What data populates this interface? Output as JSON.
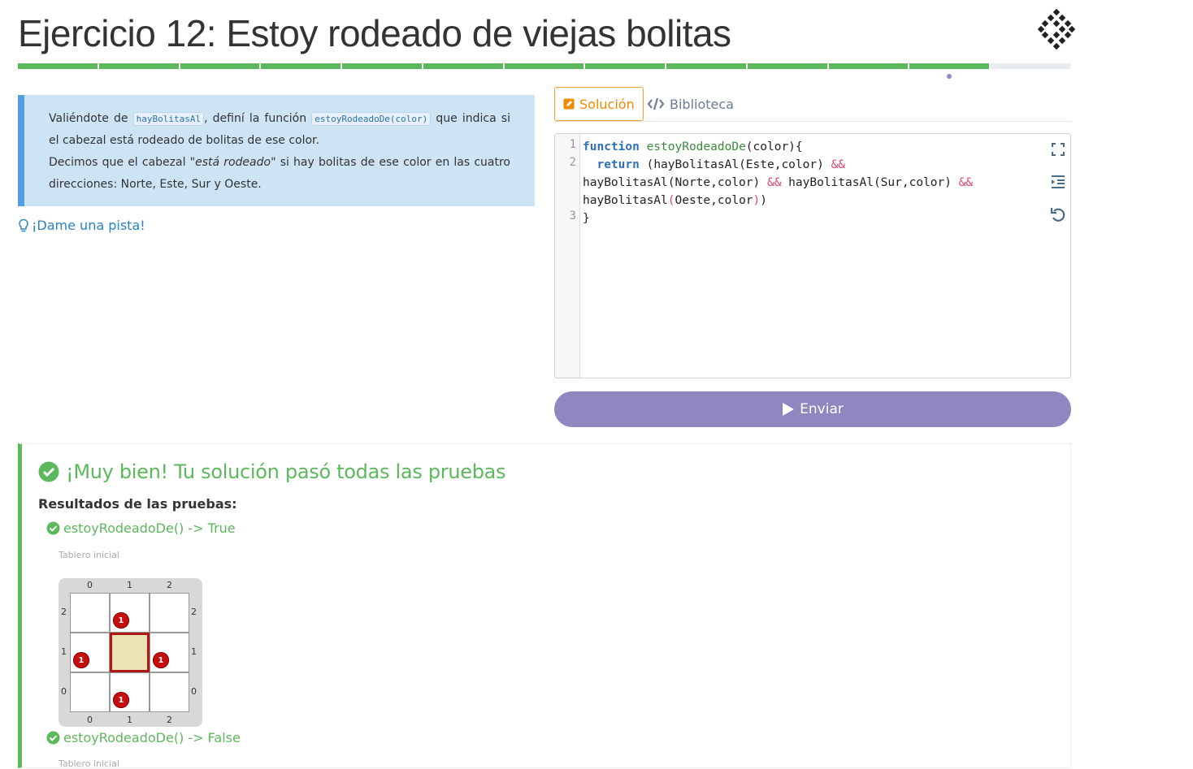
{
  "header": {
    "title": "Ejercicio 12: Estoy rodeado de viejas bolitas"
  },
  "progress": {
    "completed_segments": 12,
    "total_segments": 13,
    "current_index": 12
  },
  "statement": {
    "p1_before": "Valiéndote de",
    "p1_code1": "hayBolitasAl",
    "p1_mid": ", definí la función",
    "p1_code2": "estoyRodeadoDe(color)",
    "p1_after": "que indica si el cabezal está rodeado de bolitas de ese color.",
    "p2_before": "Decimos que el cabezal",
    "p2_quote": "\"está rodeado\"",
    "p2_after": "si hay bolitas de ese color en las cuatro direcciones: Norte, Este, Sur y Oeste."
  },
  "hint": {
    "label": "¡Dame una pista!"
  },
  "tabs": {
    "solution": "Solución",
    "library": "Biblioteca"
  },
  "editor": {
    "line_numbers": [
      "1",
      "2",
      "3"
    ],
    "line1_kw": "function",
    "line1_fn": "estoyRodeadoDe",
    "line1_rest": "(color){",
    "line2_kw": "return",
    "line2_rest": " (hayBolitasAl(Este,color) ",
    "and_op": "&&",
    "line2b_a": "hayBolitasAl(Norte,color) ",
    "line2b_b": " hayBolitasAl(Sur,color) ",
    "line2c_a": "hayBolitasAl",
    "line2c_paren_open": "(",
    "line2c_b": "Oeste,color",
    "line2c_paren_close": ")",
    "line2c_end": ")",
    "line3": "}"
  },
  "submit": {
    "label": "Enviar"
  },
  "results": {
    "title": "¡Muy bien! Tu solución pasó todas las pruebas",
    "subtitle": "Resultados de las pruebas:",
    "tests": [
      {
        "label": "estoyRodeadoDe() -> True",
        "caption": "Tablero inicial"
      },
      {
        "label": "estoyRodeadoDe() -> False",
        "caption": "Tablero inicial"
      }
    ],
    "board": {
      "col_labels": [
        "0",
        "1",
        "2"
      ],
      "row_labels": [
        "2",
        "1",
        "0"
      ],
      "balls": [
        {
          "col": 1,
          "row": 2,
          "count": "1"
        },
        {
          "col": 0,
          "row": 1,
          "count": "1"
        },
        {
          "col": 2,
          "row": 1,
          "count": "1"
        },
        {
          "col": 1,
          "row": 0,
          "count": "1"
        }
      ],
      "head": {
        "col": 1,
        "row": 1
      },
      "ball_color": "#c50f0f"
    }
  },
  "colors": {
    "success": "#5cb85c",
    "accent": "#f08a00",
    "submit": "#9286c1",
    "info_bg": "#cde4f5"
  }
}
